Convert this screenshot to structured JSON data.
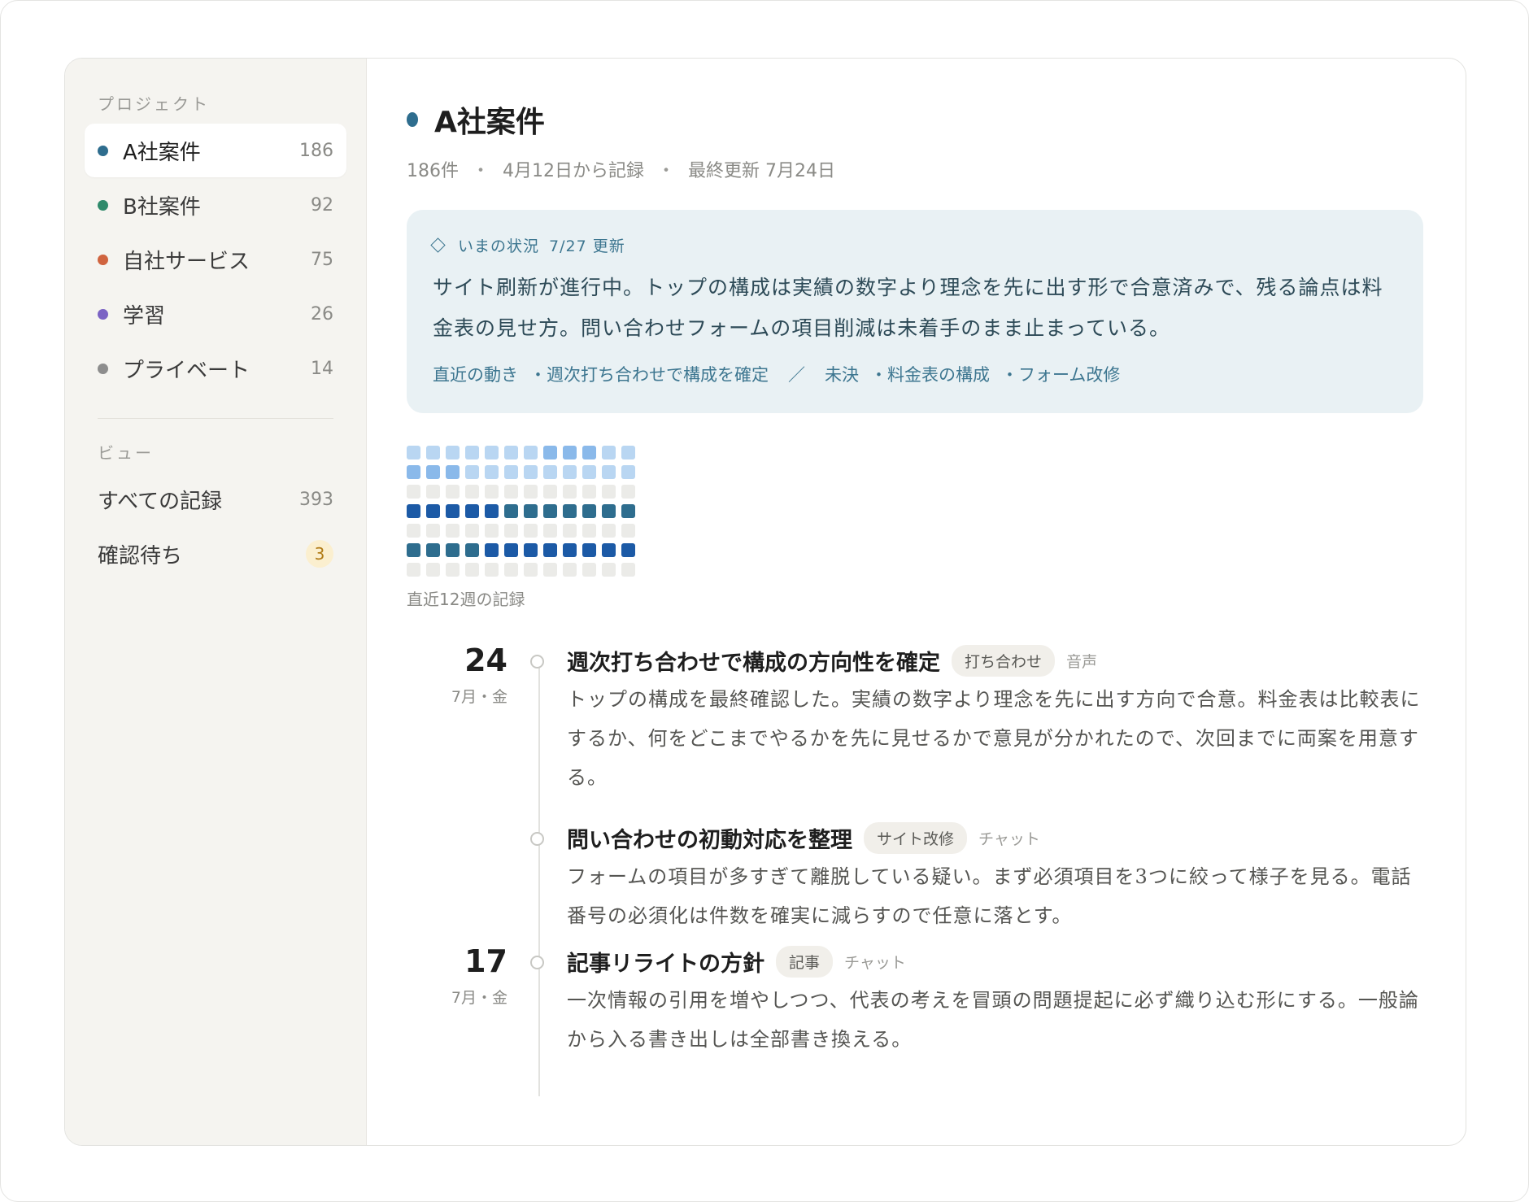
{
  "sidebar": {
    "projects_label": "プロジェクト",
    "projects": [
      {
        "label": "A社案件",
        "count": "186",
        "color": "#2e6d8e",
        "active": true
      },
      {
        "label": "B社案件",
        "count": "92",
        "color": "#2f8a6b",
        "active": false
      },
      {
        "label": "自社サービス",
        "count": "75",
        "color": "#d0643f",
        "active": false
      },
      {
        "label": "学習",
        "count": "26",
        "color": "#7b63c4",
        "active": false
      },
      {
        "label": "プライベート",
        "count": "14",
        "color": "#8d8d8d",
        "active": false
      }
    ],
    "views_label": "ビュー",
    "views": [
      {
        "label": "すべての記録",
        "count": "393"
      },
      {
        "label": "確認待ち",
        "count": "3"
      }
    ]
  },
  "main": {
    "title": "A社案件",
    "meta": [
      "186件",
      "4月12日から記録",
      "最終更新 7月24日"
    ],
    "status": {
      "head_label": "いまの状況",
      "updated": "7/27 更新",
      "body": "サイト刷新が進行中。トップの構成は実績の数字より理念を先に出す形で合意済みで、残る論点は料金表の見せ方。問い合わせフォームの項目削減は未着手のまま止まっている。",
      "recent_label": "直近の動き",
      "recent_items": [
        "・週次打ち合わせで構成を確定"
      ],
      "separator": "／",
      "pending_label": "未決",
      "pending_items": [
        "・料金表の構成",
        "・フォーム改修"
      ]
    },
    "heatmap": {
      "label": "直近12週の記録",
      "palette": [
        "#ebebe8",
        "#b9d6f2",
        "#8ab9ea",
        "#2e6d8e",
        "#1c5aa6"
      ],
      "rows": [
        [
          1,
          1,
          1,
          1,
          1,
          1,
          1,
          2,
          2,
          2,
          1,
          1
        ],
        [
          2,
          2,
          2,
          1,
          1,
          1,
          1,
          1,
          1,
          1,
          1,
          1
        ],
        [
          0,
          0,
          0,
          0,
          0,
          0,
          0,
          0,
          0,
          0,
          0,
          0
        ],
        [
          4,
          4,
          4,
          4,
          4,
          3,
          3,
          3,
          3,
          3,
          3,
          3
        ],
        [
          0,
          0,
          0,
          0,
          0,
          0,
          0,
          0,
          0,
          0,
          0,
          0
        ],
        [
          3,
          3,
          3,
          3,
          4,
          4,
          4,
          4,
          4,
          4,
          4,
          4
        ],
        [
          0,
          0,
          0,
          0,
          0,
          0,
          0,
          0,
          0,
          0,
          0,
          0
        ]
      ]
    },
    "timeline": [
      {
        "day": "24",
        "sub": "7月・金",
        "title": "週次打ち合わせで構成の方向性を確定",
        "tag": "打ち合わせ",
        "source": "音声",
        "body": "トップの構成を最終確認した。実績の数字より理念を先に出す方向で合意。料金表は比較表にするか、何をどこまでやるかを先に見せるかで意見が分かれたので、次回までに両案を用意する。"
      },
      {
        "day": "",
        "sub": "",
        "title": "問い合わせの初動対応を整理",
        "tag": "サイト改修",
        "source": "チャット",
        "body": "フォームの項目が多すぎて離脱している疑い。まず必須項目を3つに絞って様子を見る。電話番号の必須化は件数を確実に減らすので任意に落とす。"
      },
      {
        "day": "17",
        "sub": "7月・金",
        "title": "記事リライトの方針",
        "tag": "記事",
        "source": "チャット",
        "body": "一次情報の引用を増やしつつ、代表の考えを冒頭の問題提起に必ず織り込む形にする。一般論から入る書き出しは全部書き換える。"
      }
    ]
  }
}
